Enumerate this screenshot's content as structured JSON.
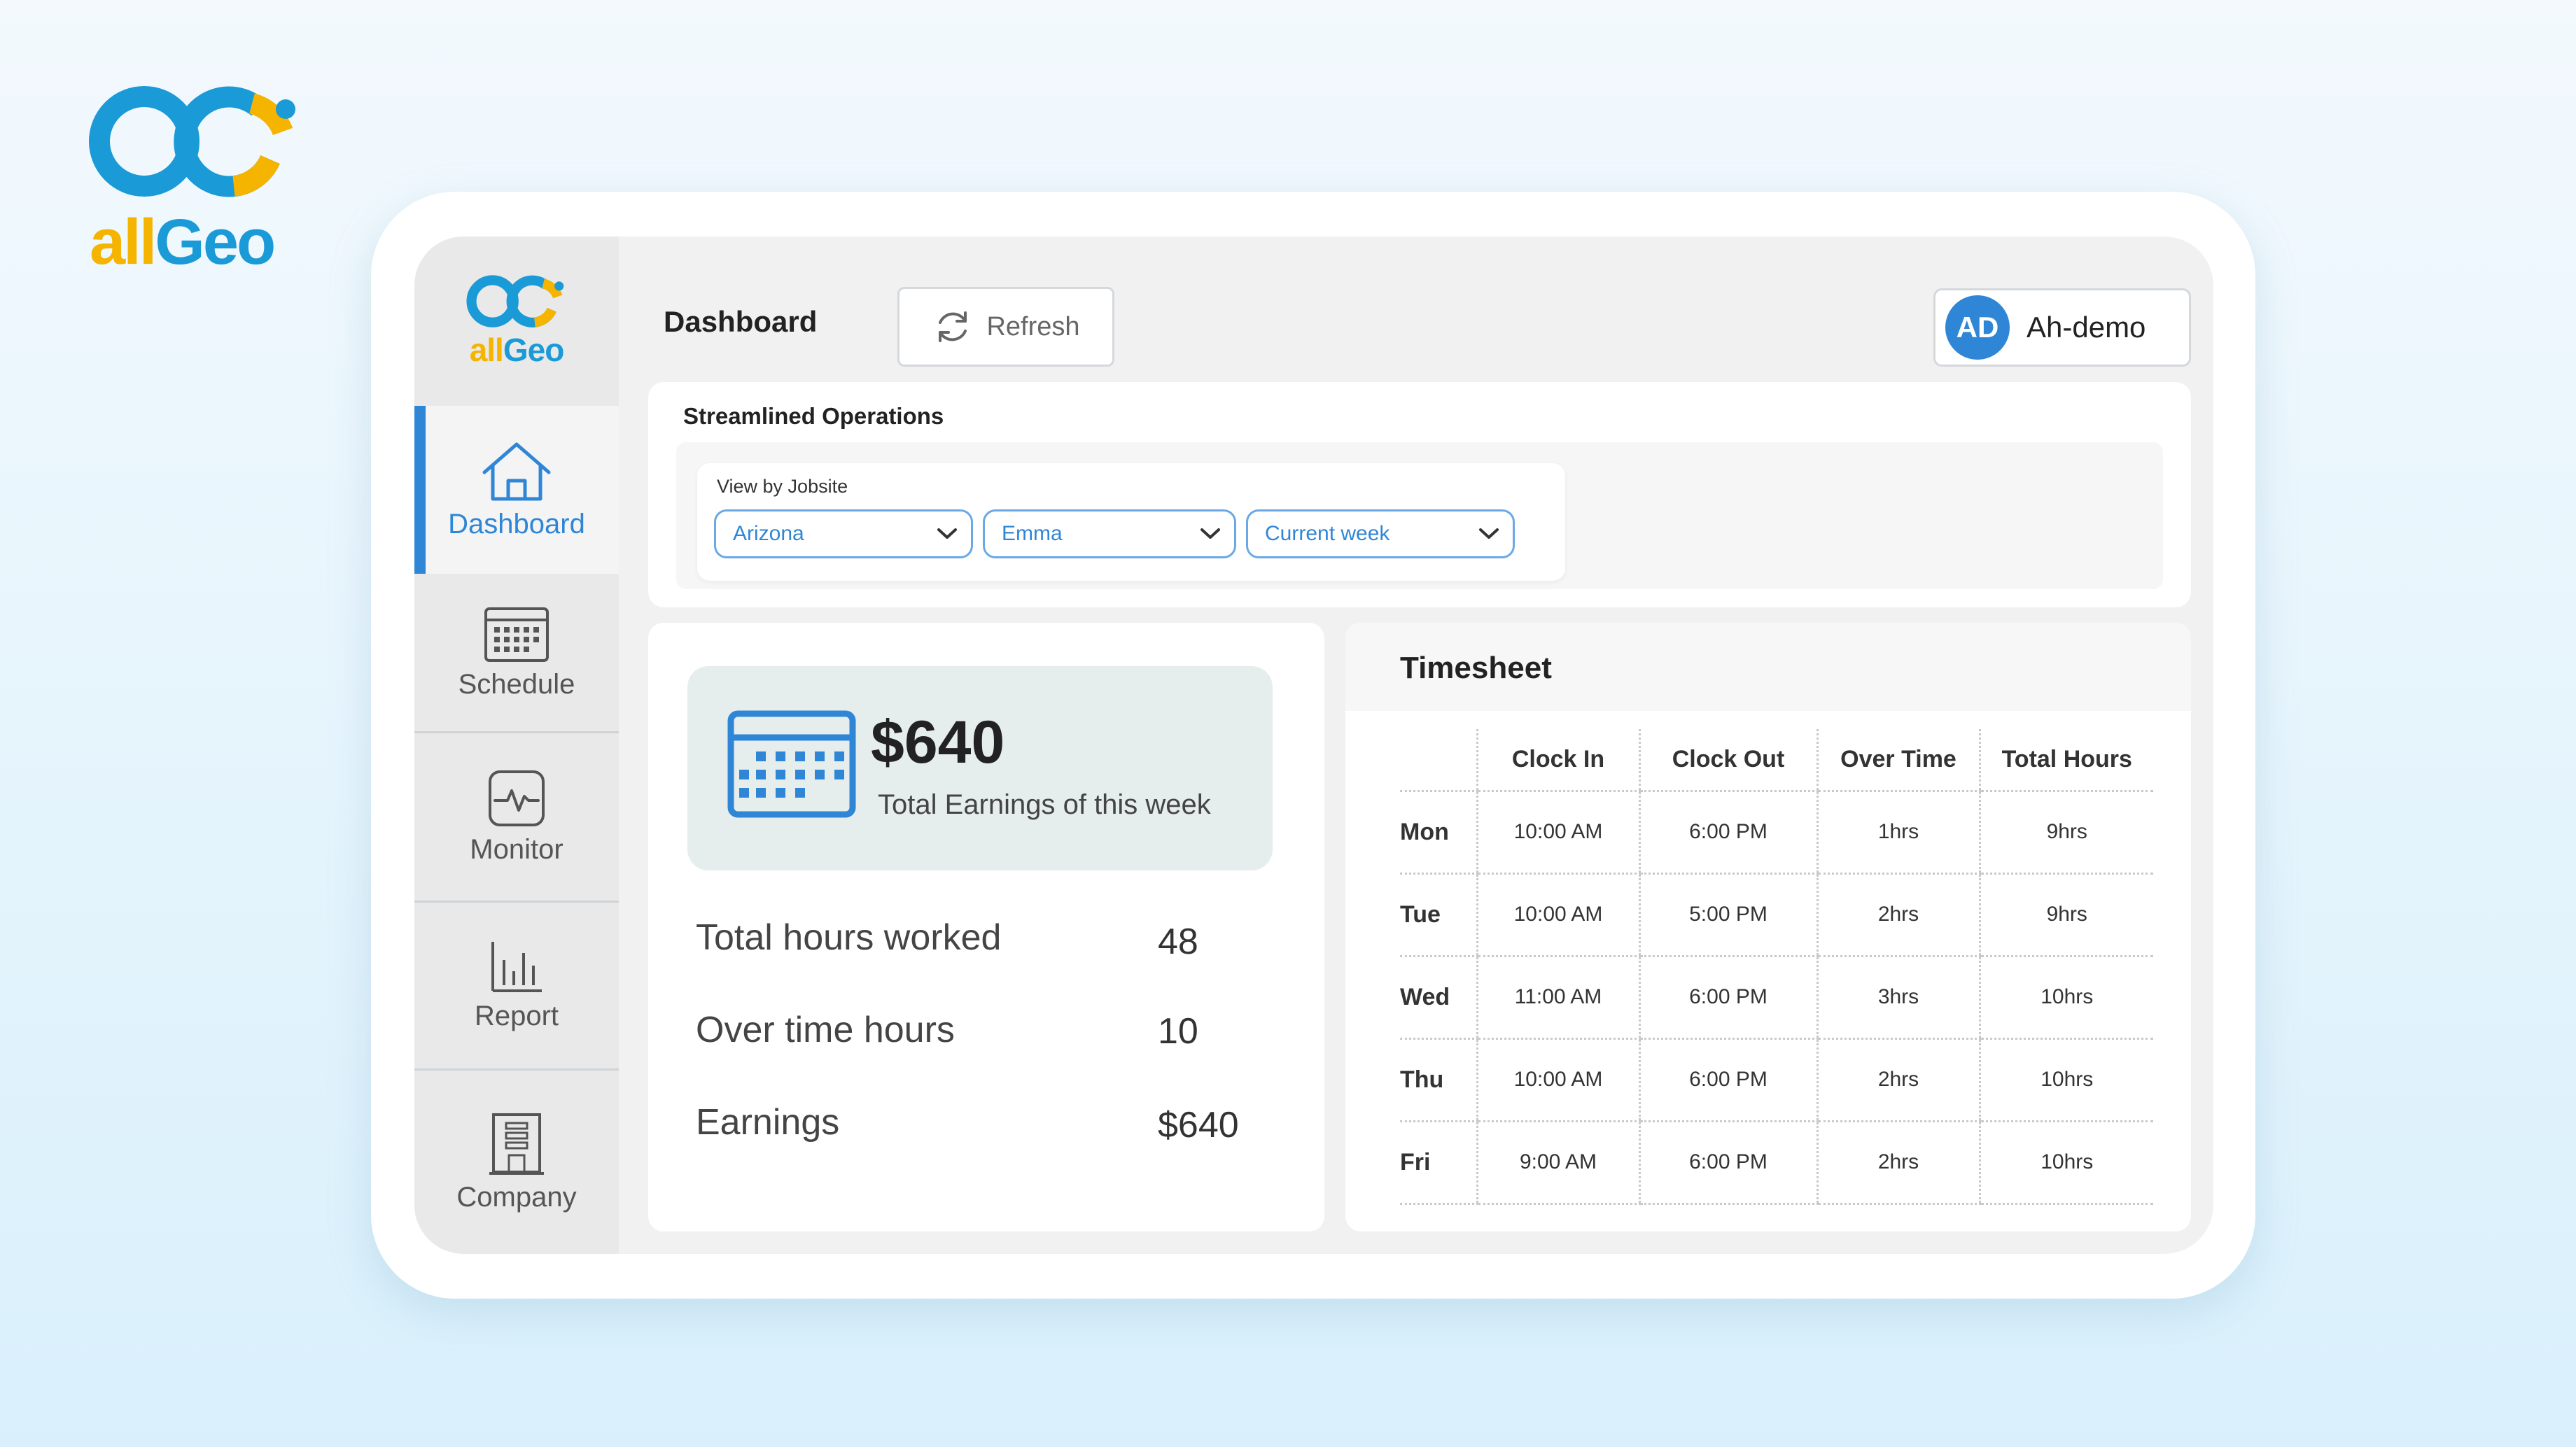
{
  "brand": {
    "all": "all",
    "geo": "Geo"
  },
  "sidebar": {
    "logo": {
      "all": "all",
      "geo": "Geo"
    },
    "items": [
      {
        "label": "Dashboard",
        "icon": "home-icon",
        "active": true
      },
      {
        "label": "Schedule",
        "icon": "calendar-icon"
      },
      {
        "label": "Monitor",
        "icon": "monitor-icon"
      },
      {
        "label": "Report",
        "icon": "bar-chart-icon"
      },
      {
        "label": "Company",
        "icon": "building-icon"
      }
    ]
  },
  "header": {
    "title": "Dashboard",
    "refresh_label": "Refresh",
    "user": {
      "initials": "AD",
      "name": "Ah-demo"
    }
  },
  "operations": {
    "title": "Streamlined Operations",
    "filter_label": "View by Jobsite",
    "filters": [
      {
        "value": "Arizona"
      },
      {
        "value": "Emma"
      },
      {
        "value": "Current week"
      }
    ]
  },
  "earnings": {
    "amount": "$640",
    "caption": "Total Earnings of this week",
    "stats": [
      {
        "label": "Total hours worked",
        "value": "48"
      },
      {
        "label": "Over time hours",
        "value": "10"
      },
      {
        "label": "Earnings",
        "value": "$640"
      }
    ]
  },
  "timesheet": {
    "title": "Timesheet",
    "columns": [
      "",
      "Clock In",
      "Clock Out",
      "Over Time",
      "Total Hours"
    ],
    "rows": [
      {
        "day": "Mon",
        "in": "10:00 AM",
        "out": "6:00 PM",
        "ot": "1hrs",
        "total": "9hrs"
      },
      {
        "day": "Tue",
        "in": "10:00 AM",
        "out": "5:00 PM",
        "ot": "2hrs",
        "total": "9hrs"
      },
      {
        "day": "Wed",
        "in": "11:00 AM",
        "out": "6:00 PM",
        "ot": "3hrs",
        "total": "10hrs"
      },
      {
        "day": "Thu",
        "in": "10:00 AM",
        "out": "6:00 PM",
        "ot": "2hrs",
        "total": "10hrs"
      },
      {
        "day": "Fri",
        "in": "9:00 AM",
        "out": "6:00 PM",
        "ot": "2hrs",
        "total": "10hrs"
      }
    ]
  },
  "colors": {
    "accent": "#2f86d6",
    "brand_yellow": "#f4b400",
    "brand_blue": "#1a9ad6"
  }
}
